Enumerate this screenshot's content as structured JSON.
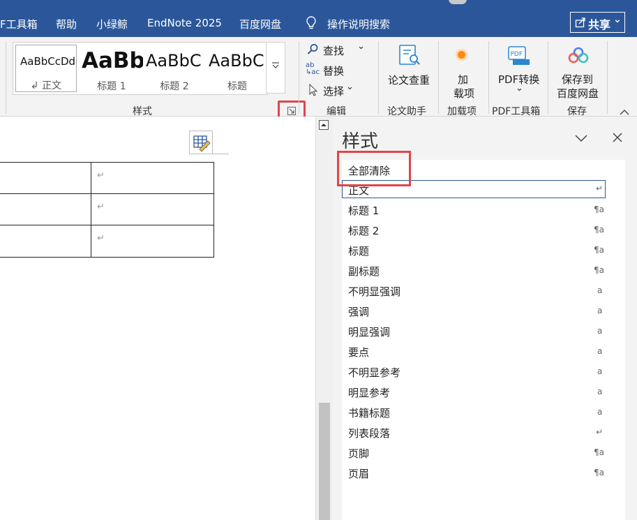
{
  "menubar": {
    "items": [
      "F工具箱",
      "帮助",
      "小绿鲸",
      "EndNote 2025",
      "百度网盘",
      "操作说明搜索"
    ],
    "share_label": "共享",
    "accent": "#2b579a"
  },
  "ribbon": {
    "styles_gallery": [
      {
        "preview": "AaBbCcDd",
        "name": "正文"
      },
      {
        "preview": "AaBb",
        "name": "标题 1"
      },
      {
        "preview": "AaBbC",
        "name": "标题 2"
      },
      {
        "preview": "AaBbC",
        "name": "标题"
      }
    ],
    "styles_group_label": "样式",
    "editing": {
      "find": "查找",
      "replace": "替换",
      "select": "选择",
      "group_label": "编辑"
    },
    "paper": {
      "button": "论文查重",
      "group_label": "论文助手"
    },
    "addins": {
      "button_line1": "加",
      "button_line2": "载项",
      "group_label": "加载项"
    },
    "pdf": {
      "button": "PDF转换",
      "group_label": "PDF工具箱"
    },
    "save": {
      "button_line1": "保存到",
      "button_line2": "百度网盘",
      "group_label": "保存"
    },
    "highlight_color": "#e0454a"
  },
  "pane": {
    "title": "样式",
    "clear_all": "全部清除",
    "styles": [
      {
        "name": "正文",
        "icon": "↵"
      },
      {
        "name": "标题 1",
        "icon": "¶a"
      },
      {
        "name": "标题 2",
        "icon": "¶a"
      },
      {
        "name": "标题",
        "icon": "¶a"
      },
      {
        "name": "副标题",
        "icon": "¶a"
      },
      {
        "name": "不明显强调",
        "icon": "a"
      },
      {
        "name": "强调",
        "icon": "a"
      },
      {
        "name": "明显强调",
        "icon": "a"
      },
      {
        "name": "要点",
        "icon": "a"
      },
      {
        "name": "不明显参考",
        "icon": "a"
      },
      {
        "name": "明显参考",
        "icon": "a"
      },
      {
        "name": "书籍标题",
        "icon": "a"
      },
      {
        "name": "列表段落",
        "icon": "↵"
      },
      {
        "name": "页脚",
        "icon": "¶a"
      },
      {
        "name": "页眉",
        "icon": "¶a"
      }
    ]
  },
  "document": {
    "cell_mark": "↵"
  }
}
